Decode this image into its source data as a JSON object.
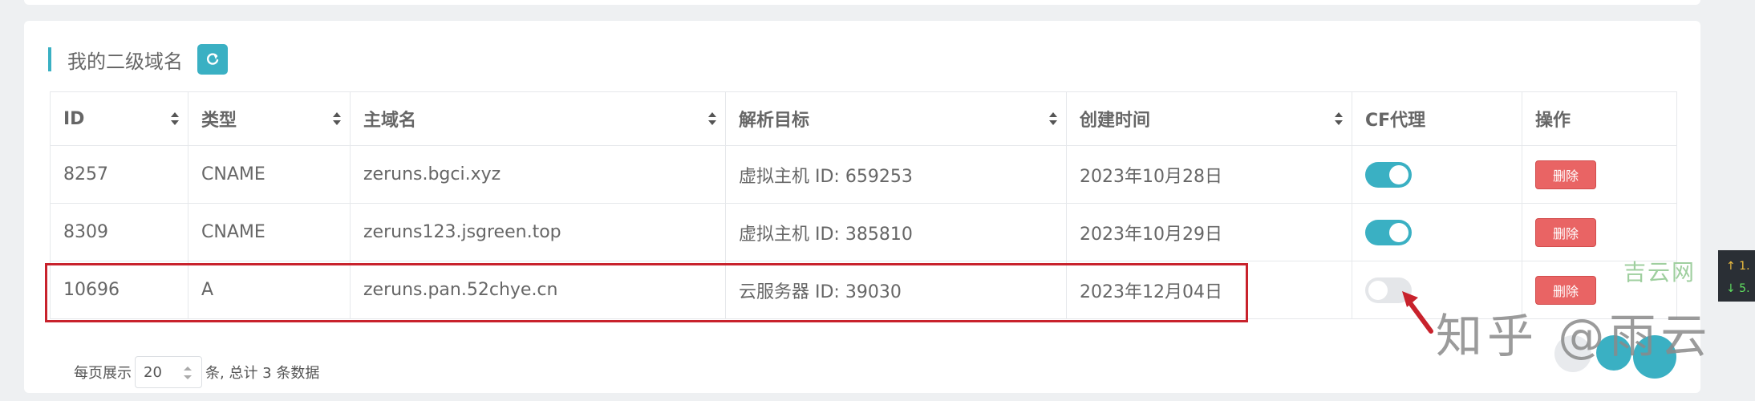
{
  "section": {
    "title": "我的二级域名"
  },
  "table": {
    "columns": [
      "ID",
      "类型",
      "主域名",
      "解析目标",
      "创建时间",
      "CF代理",
      "操作"
    ],
    "rows": [
      {
        "id": "8257",
        "type": "CNAME",
        "domain": "zeruns.bgci.xyz",
        "target": "虚拟主机 ID: 659253",
        "created": "2023年10月28日",
        "cf_proxy": true,
        "action": "删除"
      },
      {
        "id": "8309",
        "type": "CNAME",
        "domain": "zeruns123.jsgreen.top",
        "target": "虚拟主机 ID: 385810",
        "created": "2023年10月29日",
        "cf_proxy": true,
        "action": "删除"
      },
      {
        "id": "10696",
        "type": "A",
        "domain": "zeruns.pan.52chye.cn",
        "target": "云服务器 ID: 39030",
        "created": "2023年12月04日",
        "cf_proxy": false,
        "action": "删除"
      }
    ]
  },
  "pagination": {
    "prefix": "每页展示",
    "page_size": "20",
    "suffix": "条, 总计 3 条数据"
  },
  "watermarks": {
    "brand": "吉云网",
    "zhihu": "知乎 @雨云"
  },
  "side_widget": {
    "up": "↑ 1.",
    "down": "↓ 5."
  },
  "colors": {
    "accent": "#3ab0c3",
    "danger": "#e96464",
    "highlight": "#c8222c"
  }
}
